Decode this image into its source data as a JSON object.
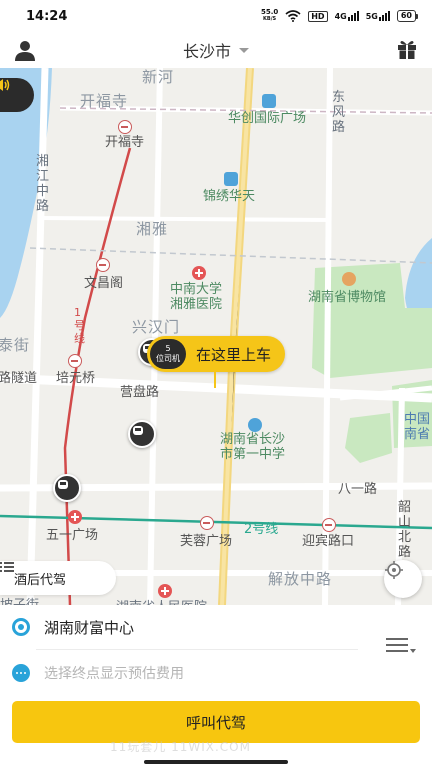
{
  "status_bar": {
    "time": "14:24",
    "net_speed": "55.0",
    "net_unit": "KB/S",
    "hd": "HD",
    "signal1": "4G",
    "signal2": "5G",
    "battery": "60"
  },
  "header": {
    "city": "长沙市"
  },
  "map": {
    "labels": {
      "xinfu": "新河",
      "kaifusi_area": "开福寺",
      "kaifusi_metro": "开福寺",
      "huayin": "华创国际广场",
      "dongfeng": "东风路",
      "xiangjiang": "湘江中路",
      "jinxiu": "锦绣华天",
      "xiangya": "湘雅",
      "wenchangge": "文昌阁",
      "zhongnan": "中南大学湘雅医院",
      "museum": "湖南省博物馆",
      "xinghanmen": "兴汉门",
      "taijie": "泰街",
      "peiyuanqiao": "培元桥",
      "suidao": "路隧道",
      "yingpan": "营盘路",
      "school": "湖南省长沙市第一中学",
      "zhongguo": "中国南省",
      "bayi": "八一路",
      "shaoshan": "韶山北路",
      "wuyi": "五一广场",
      "furong": "芙蓉广场",
      "line2": "2号线",
      "yingbin": "迎宾路口",
      "jiefang": "解放中路",
      "hospital_bottom": "湖南省人民医院",
      "pozi": "坡子街",
      "line1": "1号线"
    },
    "pickup": {
      "driver_count": "5",
      "driver_unit": "位司机",
      "text": "在这里上车"
    },
    "service_tab": "酒后代驾"
  },
  "panel": {
    "start": "湖南财富中心",
    "end_placeholder": "选择终点显示预估费用",
    "call_button": "呼叫代驾",
    "watermark": "11玩套儿 11WIX.COM"
  }
}
